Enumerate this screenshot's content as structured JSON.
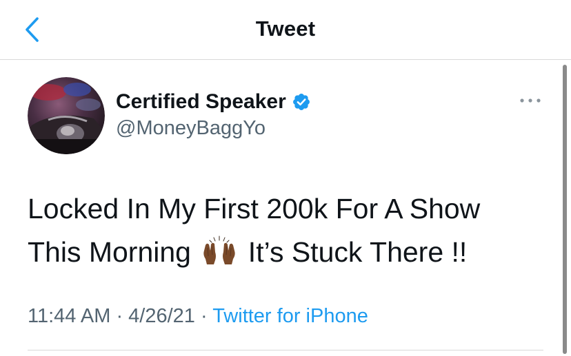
{
  "header": {
    "title": "Tweet",
    "back_icon": "chevron-left-icon"
  },
  "tweet": {
    "author": {
      "name": "Certified Speaker",
      "handle": "@MoneyBaggYo",
      "verified": true,
      "verified_icon": "verified-badge-icon"
    },
    "more_icon": "more-horizontal-icon",
    "text": {
      "line1": "Locked In My First 200k For A Show",
      "line2_before_emoji": "This Morning",
      "emoji": "raised-hands-emoji",
      "line2_after_emoji": "It’s Stuck There !!"
    },
    "meta": {
      "time": "11:44 AM",
      "separator1": " · ",
      "date": "4/26/21",
      "separator2": " · ",
      "source": "Twitter for iPhone"
    }
  },
  "colors": {
    "accent": "#1d9bf0",
    "text_primary": "#0f1419",
    "text_secondary": "#536471",
    "divider": "#d8d8d8"
  }
}
